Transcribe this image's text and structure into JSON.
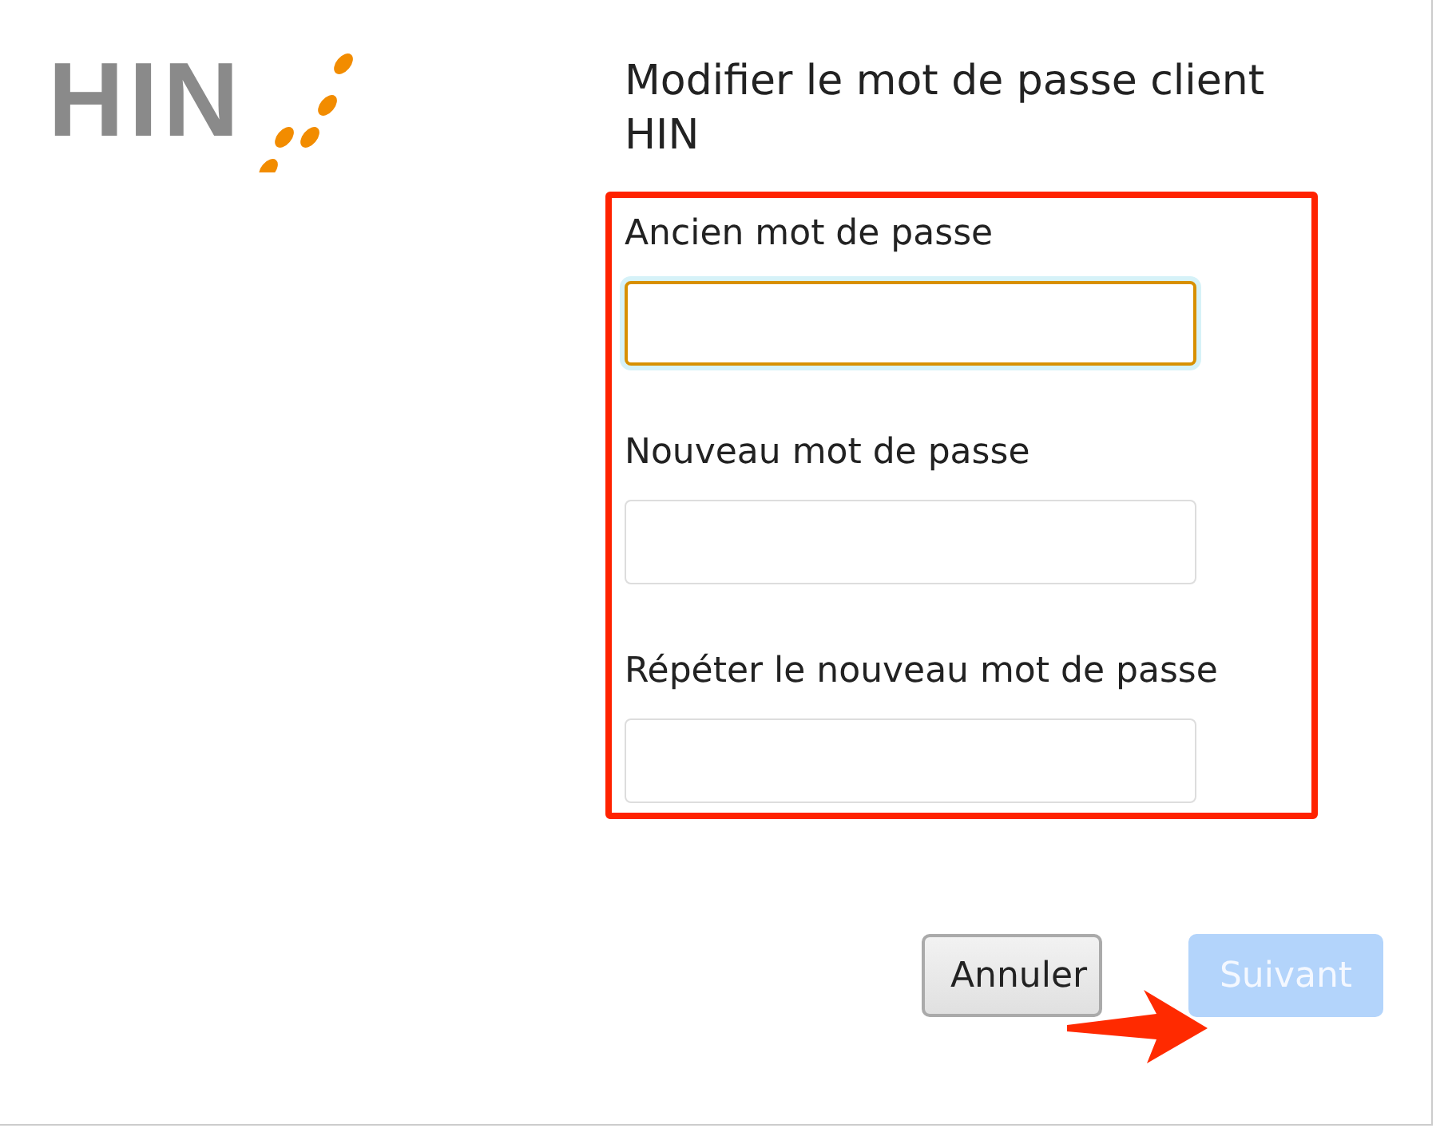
{
  "logo": {
    "text": "HIN"
  },
  "title": "Modifier le mot de passe client HIN",
  "fields": [
    {
      "label": "Ancien mot de passe",
      "focused": true
    },
    {
      "label": "Nouveau mot de passe",
      "focused": false
    },
    {
      "label": "Répéter le nouveau mot de passe",
      "focused": false
    }
  ],
  "buttons": [
    {
      "label": "Annuler",
      "kind": "secondary",
      "disabled": false
    },
    {
      "label": "Suivant",
      "kind": "primary",
      "disabled": true
    }
  ]
}
